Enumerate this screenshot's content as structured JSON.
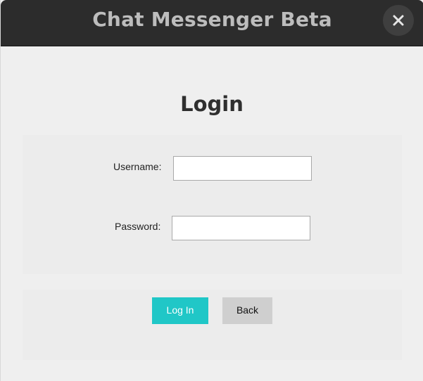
{
  "window": {
    "title": "Chat Messenger Beta",
    "close_icon": "close-icon"
  },
  "login": {
    "heading": "Login",
    "username_label": "Username:",
    "username_value": "",
    "password_label": "Password:",
    "password_value": "",
    "login_button": "Log In",
    "back_button": "Back"
  },
  "colors": {
    "titlebar_bg": "#2c2c2c",
    "title_text": "#bdbdbd",
    "window_bg": "#efefef",
    "login_button_bg": "#20c7c7",
    "back_button_bg": "#cfcfcf"
  }
}
